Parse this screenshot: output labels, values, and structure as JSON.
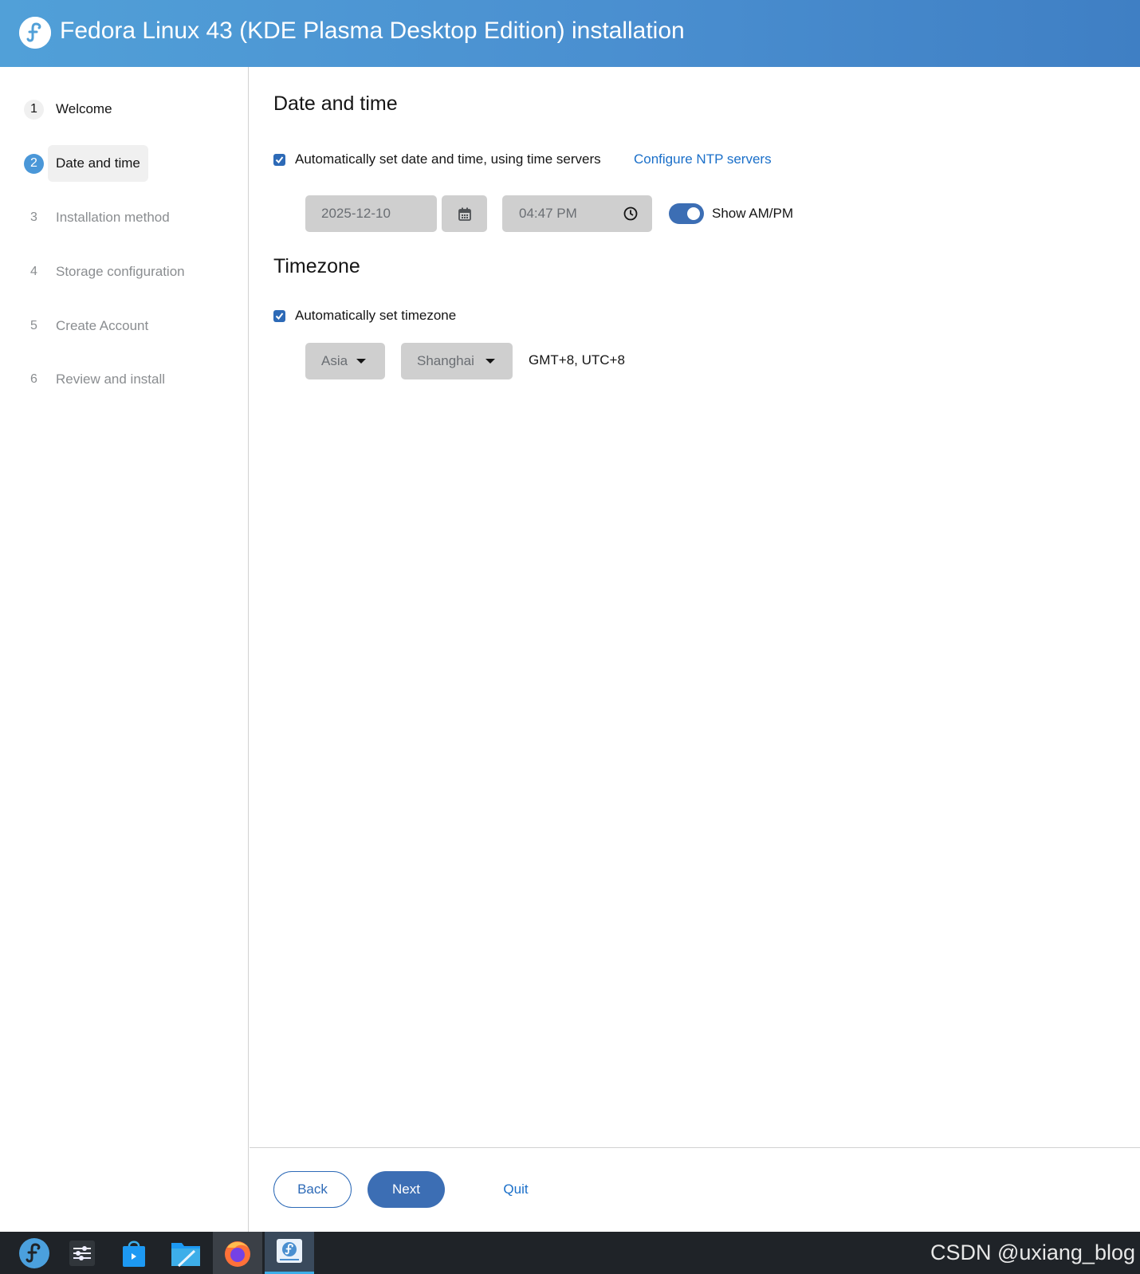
{
  "header": {
    "title": "Fedora Linux 43 (KDE Plasma Desktop Edition) installation",
    "logo_icon": "fedora-logo"
  },
  "sidebar": {
    "steps": [
      {
        "number": "1",
        "label": "Welcome",
        "state": "done"
      },
      {
        "number": "2",
        "label": "Date and time",
        "state": "current"
      },
      {
        "number": "3",
        "label": "Installation method",
        "state": "future"
      },
      {
        "number": "4",
        "label": "Storage configuration",
        "state": "future"
      },
      {
        "number": "5",
        "label": "Create Account",
        "state": "future"
      },
      {
        "number": "6",
        "label": "Review and install",
        "state": "future"
      }
    ]
  },
  "date_time": {
    "heading": "Date and time",
    "auto_label": "Automatically set date and time, using time servers",
    "auto_checked": true,
    "ntp_link": "Configure NTP servers",
    "date_value": "2025-12-10",
    "time_value": "04:47 PM",
    "ampm_label": "Show AM/PM",
    "ampm_on": true
  },
  "timezone": {
    "heading": "Timezone",
    "auto_label": "Automatically set timezone",
    "auto_checked": true,
    "region": "Asia",
    "city": "Shanghai",
    "offset": "GMT+8, UTC+8"
  },
  "footer": {
    "back_label": "Back",
    "next_label": "Next",
    "quit_label": "Quit"
  },
  "taskbar": {
    "items": [
      "fedora-launcher-icon",
      "system-settings-icon",
      "discover-store-icon",
      "file-manager-icon",
      "firefox-icon",
      "installer-icon"
    ]
  },
  "watermark": "CSDN @uxiang_blog",
  "colors": {
    "accent": "#3c6eb4",
    "link": "#1a6fc9",
    "header": "#4a8fd0"
  }
}
